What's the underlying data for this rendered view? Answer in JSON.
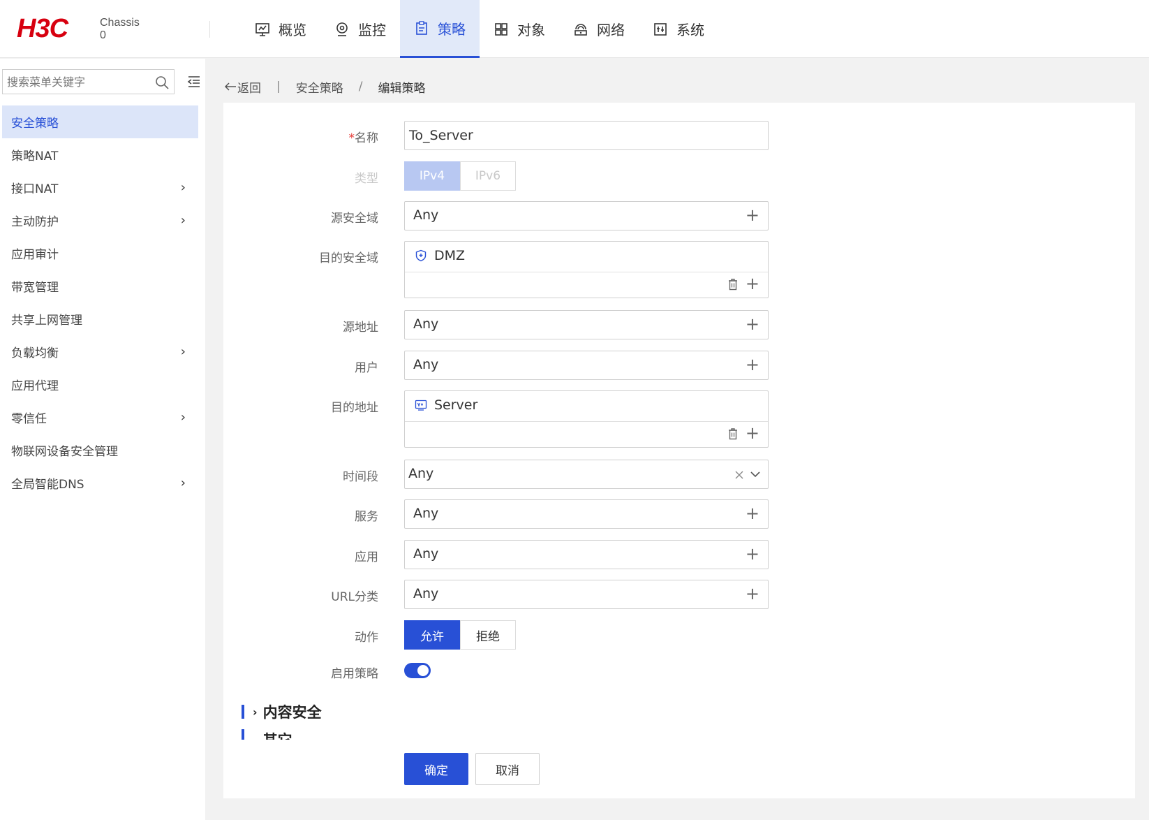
{
  "brand": {
    "logo": "H3C",
    "device_line1": "Chassis",
    "device_line2": "0"
  },
  "topnav": [
    {
      "label": "概览",
      "icon": "monitor-icon",
      "active": false
    },
    {
      "label": "监控",
      "icon": "location-pin-icon",
      "active": false
    },
    {
      "label": "策略",
      "icon": "clipboard-icon",
      "active": true
    },
    {
      "label": "对象",
      "icon": "grid-icon",
      "active": false
    },
    {
      "label": "网络",
      "icon": "network-icon",
      "active": false
    },
    {
      "label": "系统",
      "icon": "system-icon",
      "active": false
    }
  ],
  "sidebar": {
    "search_placeholder": "搜索菜单关键字",
    "items": [
      {
        "label": "安全策略",
        "expandable": false,
        "active": true
      },
      {
        "label": "策略NAT",
        "expandable": false
      },
      {
        "label": "接口NAT",
        "expandable": true
      },
      {
        "label": "主动防护",
        "expandable": true
      },
      {
        "label": "应用审计",
        "expandable": false
      },
      {
        "label": "带宽管理",
        "expandable": false
      },
      {
        "label": "共享上网管理",
        "expandable": false
      },
      {
        "label": "负载均衡",
        "expandable": true
      },
      {
        "label": "应用代理",
        "expandable": false
      },
      {
        "label": "零信任",
        "expandable": true
      },
      {
        "label": "物联网设备安全管理",
        "expandable": false
      },
      {
        "label": "全局智能DNS",
        "expandable": true
      }
    ]
  },
  "breadcrumb": {
    "back": "返回",
    "parent": "安全策略",
    "sep": "/",
    "current": "编辑策略"
  },
  "form": {
    "name": {
      "required_mark": "*",
      "label": "名称",
      "value": "To_Server"
    },
    "type": {
      "label": "类型",
      "options": [
        "IPv4",
        "IPv6"
      ],
      "selected": "IPv4"
    },
    "src_zone": {
      "label": "源安全域",
      "value": "Any"
    },
    "dst_zone": {
      "label": "目的安全域",
      "value": "DMZ"
    },
    "src_addr": {
      "label": "源地址",
      "value": "Any"
    },
    "user": {
      "label": "用户",
      "value": "Any"
    },
    "dst_addr": {
      "label": "目的地址",
      "value": "Server"
    },
    "time_range": {
      "label": "时间段",
      "value": "Any"
    },
    "service": {
      "label": "服务",
      "value": "Any"
    },
    "app": {
      "label": "应用",
      "value": "Any"
    },
    "url_cat": {
      "label": "URL分类",
      "value": "Any"
    },
    "action": {
      "label": "动作",
      "options": [
        "允许",
        "拒绝"
      ],
      "selected": "允许"
    },
    "enable": {
      "label": "启用策略",
      "on": true
    }
  },
  "sections": {
    "content_security": "内容安全",
    "other": "其它"
  },
  "buttons": {
    "ok": "确定",
    "cancel": "取消"
  },
  "colors": {
    "accent": "#2850d6",
    "brand_red": "#d7000f",
    "active_bg": "#e1e9f9"
  }
}
